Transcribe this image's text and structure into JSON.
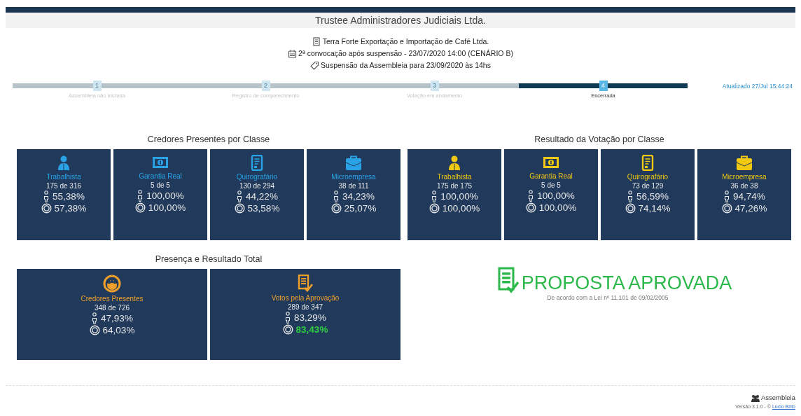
{
  "title": "Trustee Administradores Judiciais Ltda.",
  "info_lines": [
    {
      "kind": "building",
      "text": "Terra Forte Exportação e Importação de Café Ltda."
    },
    {
      "kind": "calendar",
      "text": "2ª convocação após suspensão - 23/07/2020 14:00 (CENÁRIO B)"
    },
    {
      "kind": "tag",
      "text": "Suspensão da Assembleia para 23/09/2020 às 14hs"
    }
  ],
  "steps": [
    {
      "number": "1",
      "label": "Assembleia não iniciada",
      "selected": false
    },
    {
      "number": "2",
      "label": "Registro de comparecimento",
      "selected": false
    },
    {
      "number": "3",
      "label": "Votação em andamento",
      "selected": false
    },
    {
      "number": "4",
      "label": "Encerrada",
      "selected": true
    }
  ],
  "updated": "Atualizado 27/Jul 15:44:24",
  "sections": [
    {
      "title": "Credores Presentes por Classe",
      "cards": [
        {
          "label": "Trabalhista",
          "count": "175 de 316",
          "people": "55,38%",
          "money": "57,38%"
        },
        {
          "label": "Garantia Real",
          "count": "5 de 5",
          "people": "100,00%",
          "money": "100,00%"
        },
        {
          "label": "Quirografário",
          "count": "130 de 294",
          "people": "44,22%",
          "money": "53,58%"
        },
        {
          "label": "Microempresa",
          "count": "38 de 111",
          "people": "34,23%",
          "money": "25,07%"
        }
      ]
    },
    {
      "title": "Resultado da Votação por Classe",
      "cards": [
        {
          "label": "Trabalhista",
          "count": "175 de 175",
          "people": "100,00%",
          "money": "100,00%"
        },
        {
          "label": "Garantia Real",
          "count": "5 de 5",
          "people": "100,00%",
          "money": "100,00%"
        },
        {
          "label": "Quirografário",
          "count": "73 de 129",
          "people": "56,59%",
          "money": "74,14%"
        },
        {
          "label": "Microempresa",
          "count": "36 de 38",
          "people": "94,74%",
          "money": "47,26%"
        }
      ]
    }
  ],
  "totals": {
    "title": "Presença e Resultado Total",
    "cards": [
      {
        "label": "Credores Presentes",
        "count": "348 de 726",
        "people": "47,93%",
        "money": "64,03%",
        "money_highlight": false
      },
      {
        "label": "Votos pela Aprovação",
        "count": "289 de 347",
        "people": "83,29%",
        "money": "83,43%",
        "money_highlight": true
      }
    ]
  },
  "result": {
    "title": "PROPOSTA APROVADA",
    "subtitle": "De acordo com a Lei nº 11.101 de 09/02/2005"
  },
  "footer": {
    "app": "Assembleia",
    "version": "Versão 3.1.0 - ©",
    "author": "Lúcio Brito"
  }
}
